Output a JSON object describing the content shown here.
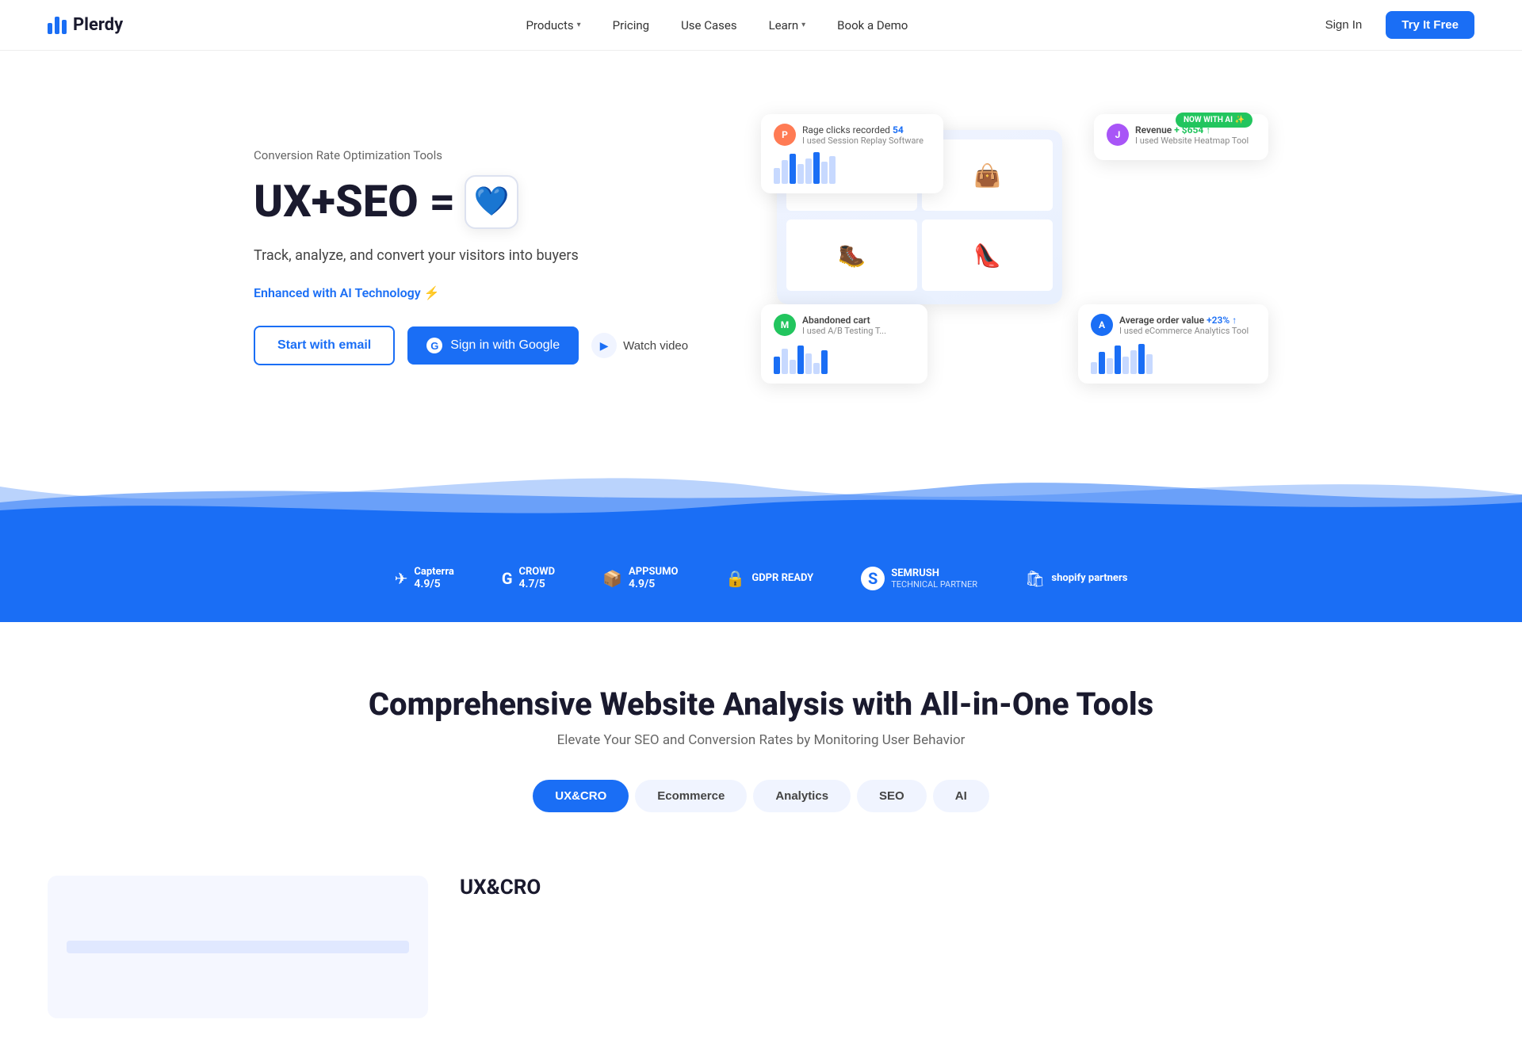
{
  "nav": {
    "logo_text": "Plerdy",
    "links": [
      {
        "label": "Products",
        "has_dropdown": true
      },
      {
        "label": "Pricing",
        "has_dropdown": false
      },
      {
        "label": "Use Cases",
        "has_dropdown": false
      },
      {
        "label": "Learn",
        "has_dropdown": true
      },
      {
        "label": "Book a Demo",
        "has_dropdown": false
      }
    ],
    "sign_in": "Sign In",
    "try_free": "Try It Free"
  },
  "hero": {
    "subtitle": "Conversion Rate Optimization Tools",
    "headline_left": "UX+SEO =",
    "heart_emoji": "💙",
    "description": "Track, analyze, and convert your visitors into buyers",
    "ai_badge": "Enhanced with AI Technology ⚡",
    "btn_email": "Start with email",
    "btn_google": "Sign in with Google",
    "btn_watch": "Watch video",
    "cards": {
      "rage": {
        "title": "Rage clicks recorded",
        "count": "54",
        "sub": "I used Session Replay Software",
        "avatar_color": "#ff7b54"
      },
      "revenue": {
        "title": "Revenue",
        "amount": "+ $654",
        "sub": "I used Website Heatmap Tool",
        "badge": "NOW WITH AI ✨",
        "avatar_color": "#a855f7"
      },
      "abandoned": {
        "title": "Abandoned cart",
        "sub": "I used A/B Testing T...",
        "avatar_color": "#22c55e"
      },
      "avg_order": {
        "title": "Average order value",
        "amount": "+23%",
        "arrow": "↑",
        "sub": "I used eCommerce Analytics Tool",
        "avatar_color": "#1a6ef5"
      }
    }
  },
  "partners": [
    {
      "name": "Capterra",
      "score": "4.9/5",
      "icon": "✈"
    },
    {
      "name": "CROWD",
      "score": "4.7/5",
      "icon": "G"
    },
    {
      "name": "APPSUMO",
      "score": "4.9/5",
      "icon": "A"
    },
    {
      "name": "GDPR",
      "label": "GDPR READY",
      "icon": "🔒"
    },
    {
      "name": "SEMRUSH",
      "label": "TECHNICAL PARTNER",
      "icon": "S"
    },
    {
      "name": "Shopify",
      "label": "shopify partners",
      "icon": "S"
    }
  ],
  "section2": {
    "heading": "Comprehensive Website Analysis with All-in-One Tools",
    "subheading": "Elevate Your SEO and Conversion Rates by Monitoring User Behavior",
    "tabs": [
      {
        "label": "UX&CRO",
        "active": true
      },
      {
        "label": "Ecommerce",
        "active": false
      },
      {
        "label": "Analytics",
        "active": false
      },
      {
        "label": "SEO",
        "active": false
      },
      {
        "label": "AI",
        "active": false
      }
    ]
  },
  "section3": {
    "title": "UX&CRO"
  }
}
